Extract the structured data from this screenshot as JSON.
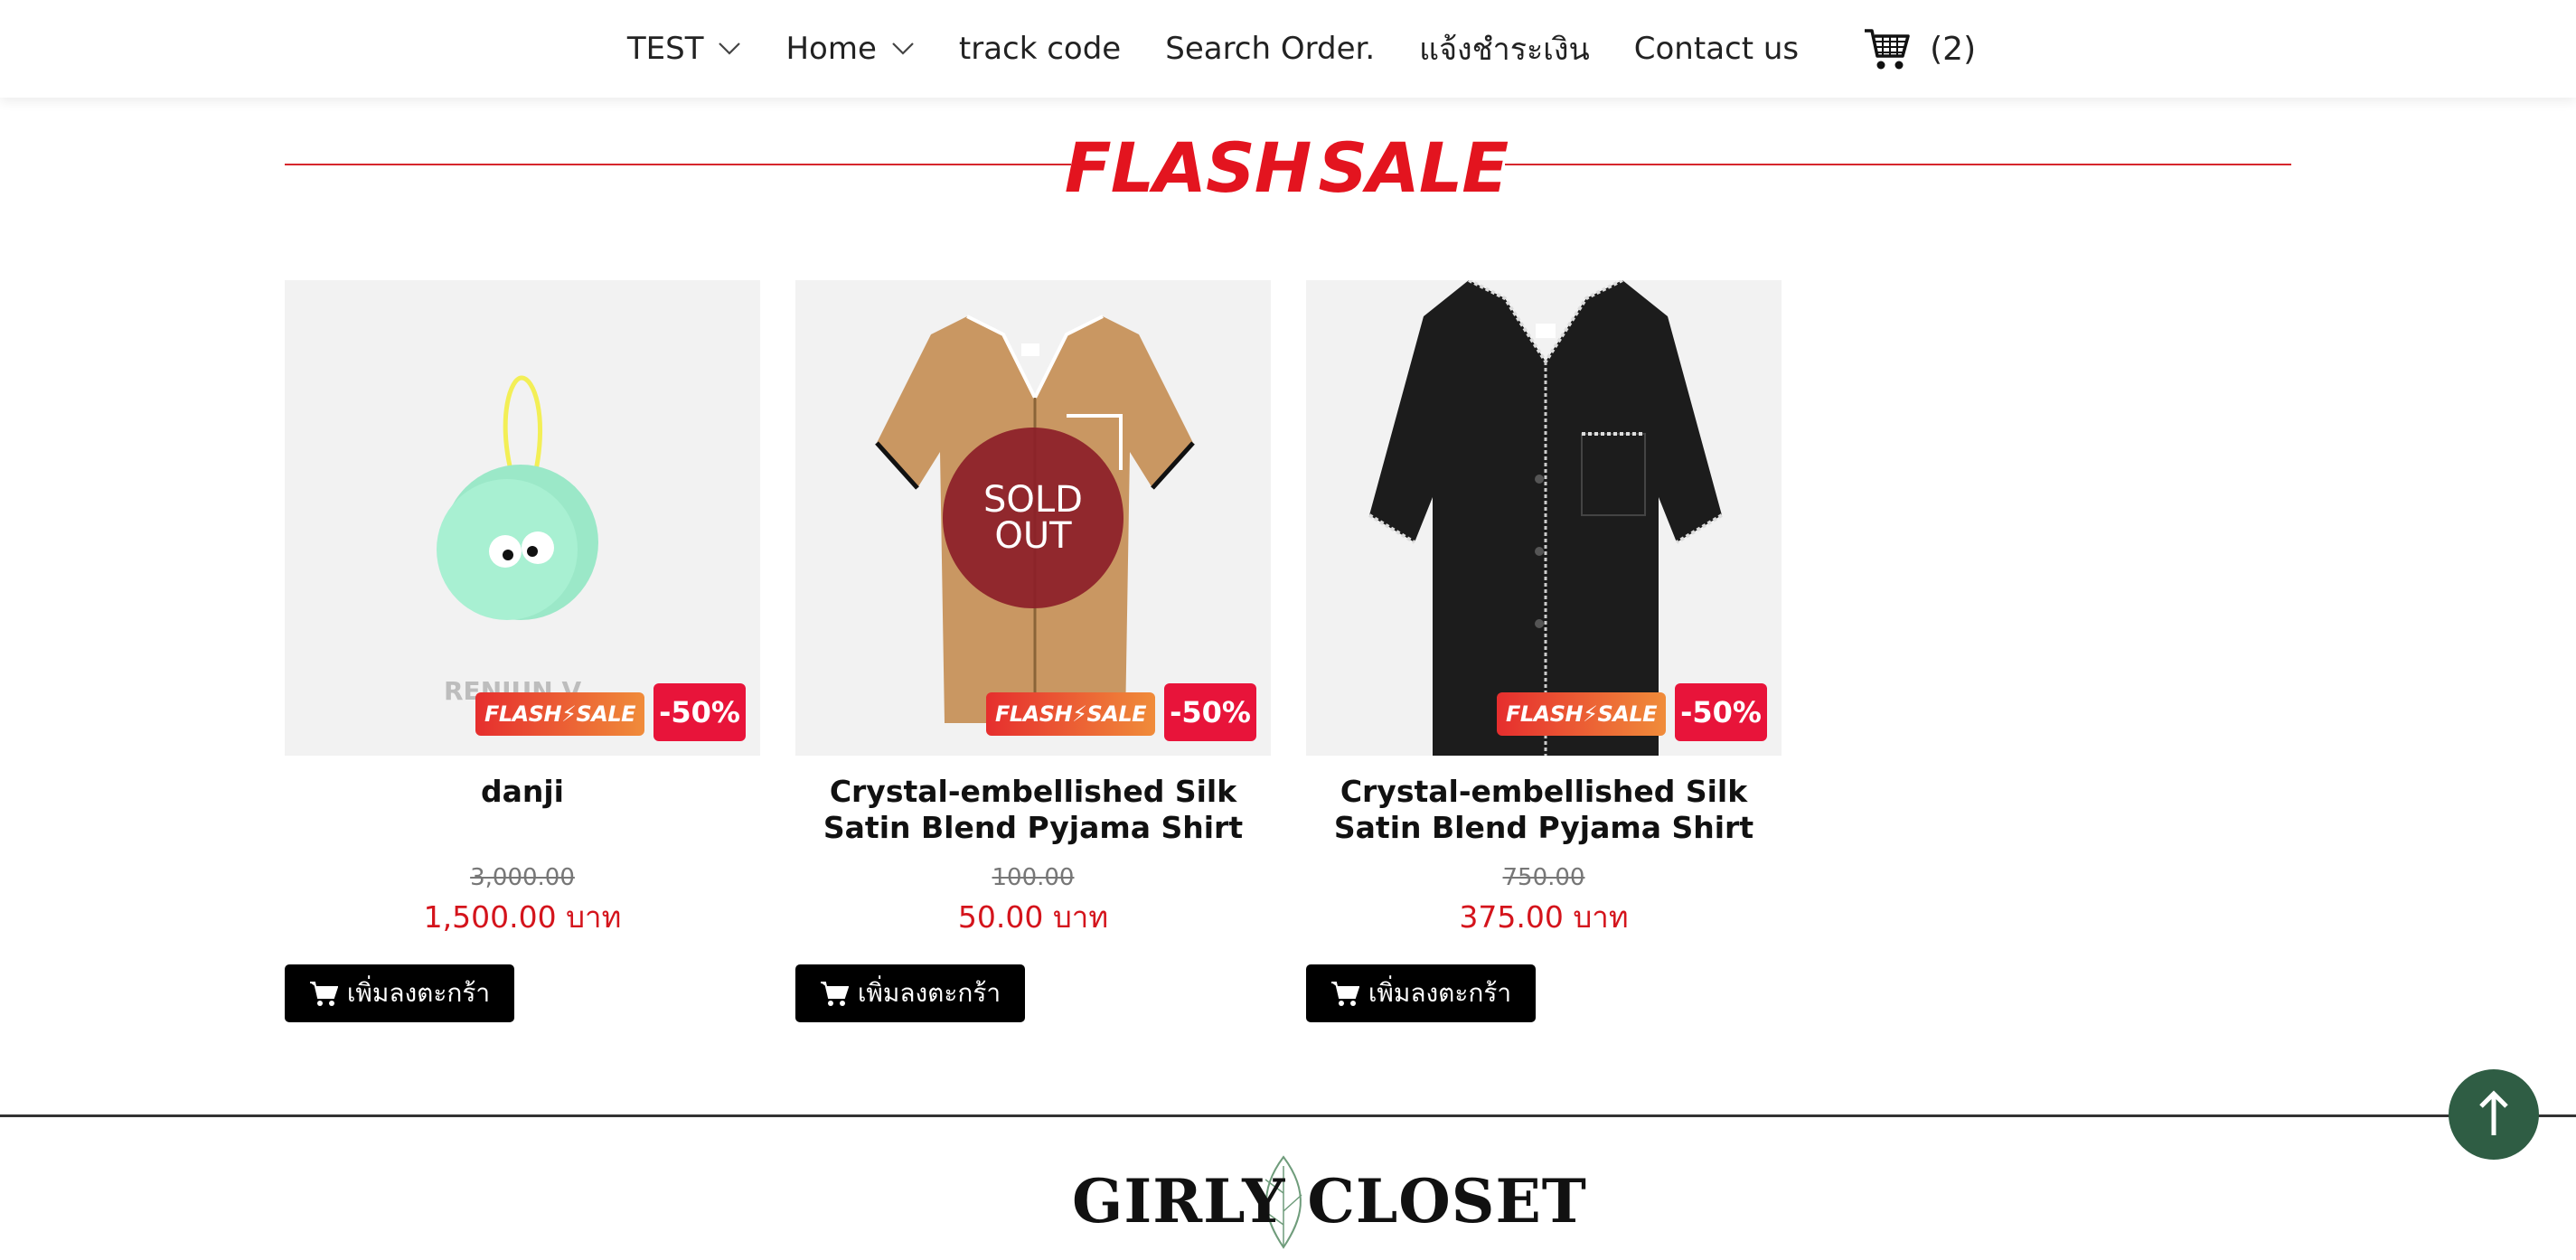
{
  "nav": {
    "items": [
      {
        "label": "TEST",
        "has_dropdown": true
      },
      {
        "label": "Home",
        "has_dropdown": true
      },
      {
        "label": "track code",
        "has_dropdown": false
      },
      {
        "label": "Search Order.",
        "has_dropdown": false
      },
      {
        "label": "แจ้งชำระเงิน",
        "has_dropdown": false
      },
      {
        "label": "Contact us",
        "has_dropdown": false
      }
    ],
    "cart_count": "(2)",
    "cart_icon": "shopping-cart-icon"
  },
  "flash_sale": {
    "word1": "FLASH",
    "word2": "SALE",
    "colors": {
      "text": "#e3141f",
      "bolt": "#f5d90a",
      "line": "#d6262c"
    }
  },
  "products": [
    {
      "name": "danji",
      "old_price": "3,000.00",
      "new_price": "1,500.00 บาท",
      "badge_flash": "FLASH⚡SALE",
      "badge_discount": "-50%",
      "sold_out": false,
      "image_text": "RENJUN V",
      "add_to_cart": "เพิ่มลงตะกร้า"
    },
    {
      "name": "Crystal-embellished Silk Satin Blend Pyjama Shirt",
      "old_price": "100.00",
      "new_price": "50.00 บาท",
      "badge_flash": "FLASH⚡SALE",
      "badge_discount": "-50%",
      "sold_out": true,
      "sold_out_label": "SOLD OUT",
      "add_to_cart": "เพิ่มลงตะกร้า"
    },
    {
      "name": "Crystal-embellished Silk Satin Blend Pyjama Shirt",
      "old_price": "750.00",
      "new_price": "375.00 บาท",
      "badge_flash": "FLASH⚡SALE",
      "badge_discount": "-50%",
      "sold_out": false,
      "add_to_cart": "เพิ่มลงตะกร้า"
    }
  ],
  "footer": {
    "logo_text": "GIRLY CLOSET"
  },
  "scroll_top": {
    "icon": "arrow-up-icon",
    "color": "#2f5d44"
  }
}
